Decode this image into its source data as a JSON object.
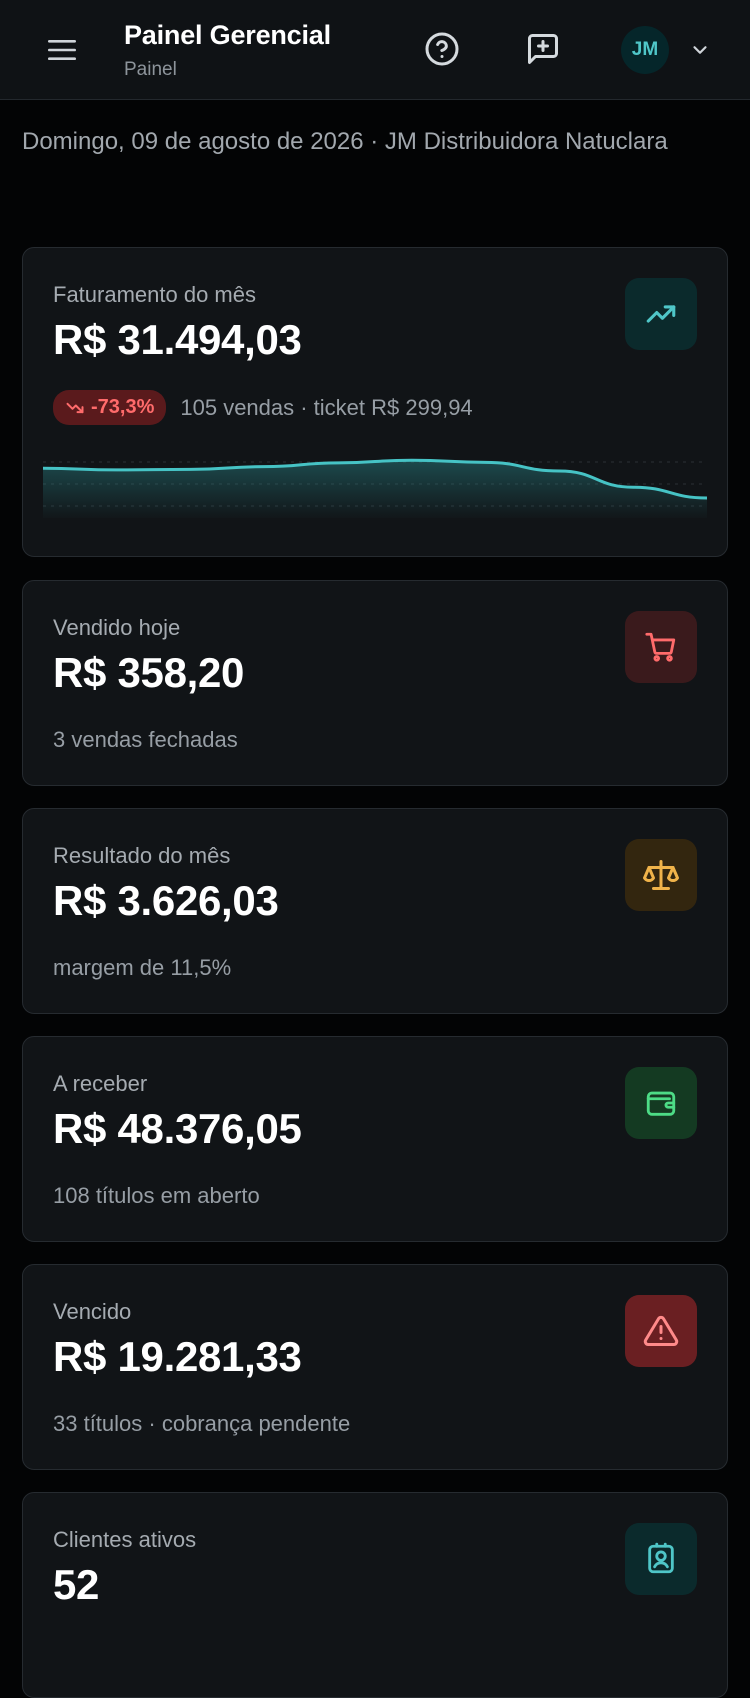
{
  "header": {
    "title": "Painel Gerencial",
    "subtitle": "Painel",
    "avatar_initials": "JM"
  },
  "date_line": "Domingo, 09 de agosto de 2026 · JM Distribuidora Natuclara",
  "cards": [
    {
      "label": "Faturamento do mês",
      "value": "R$ 31.494,03",
      "trend": "-73,3%",
      "meta": "105 vendas · ticket R$ 299,94",
      "icon": "trending-up-icon",
      "icon_color": "#4fc6c8",
      "icon_bg": "#0b2a2c",
      "sparkline": [
        0.55,
        0.52,
        0.53,
        0.58,
        0.65,
        0.7,
        0.66,
        0.5,
        0.2,
        0.0
      ]
    },
    {
      "label": "Vendido hoje",
      "value": "R$ 358,20",
      "sub": "3 vendas fechadas",
      "icon": "cart-icon",
      "icon_color": "#ff6b6b",
      "icon_bg": "#3a1a1c"
    },
    {
      "label": "Resultado do mês",
      "value": "R$ 3.626,03",
      "sub": "margem de 11,5%",
      "icon": "scale-icon",
      "icon_color": "#f0b34a",
      "icon_bg": "#33260f"
    },
    {
      "label": "A receber",
      "value": "R$ 48.376,05",
      "sub": "108 títulos em aberto",
      "icon": "wallet-icon",
      "icon_color": "#4ddc86",
      "icon_bg": "#143a22"
    },
    {
      "label": "Vencido",
      "value": "R$ 19.281,33",
      "sub": "33 títulos · cobrança pendente",
      "icon": "alert-triangle-icon",
      "icon_color": "#ff8a8a",
      "icon_bg": "#6a1f22"
    },
    {
      "label": "Clientes ativos",
      "value": "52",
      "icon": "contact-card-icon",
      "icon_color": "#4fc6c8",
      "icon_bg": "#0b2a2c"
    }
  ]
}
